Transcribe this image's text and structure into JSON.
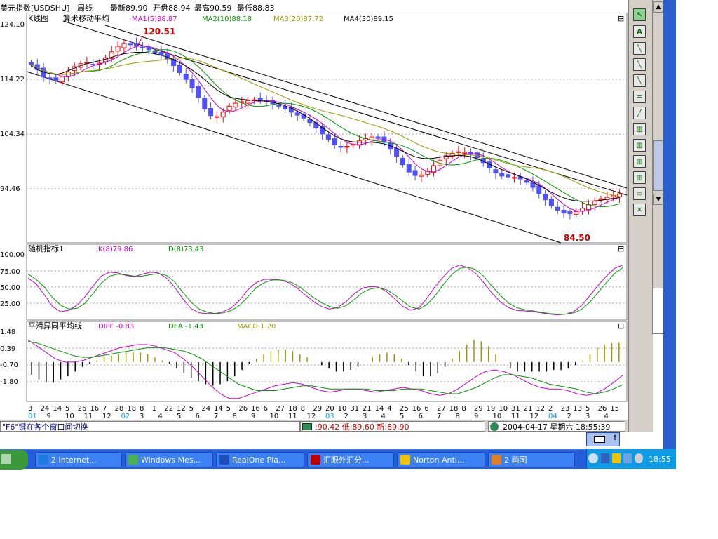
{
  "header": {
    "symbol": "美元指数[USDSHU]",
    "period": "周线",
    "latest": "最新89.90",
    "open": "开盘88.94",
    "high": "最高90.59",
    "low": "最低88.83"
  },
  "panels": {
    "kline": {
      "title": "K线图",
      "indicator": "算术移动平均",
      "ma1": "MA1(5)88.87",
      "ma2": "MA2(10)88.18",
      "ma3": "MA3(20)87.72",
      "ma4": "MA4(30)89.15",
      "high_label": "120.51",
      "low_label": "84.50",
      "yticks": [
        "124.10",
        "114.22",
        "104.34",
        "94.46"
      ]
    },
    "kd": {
      "title": "随机指标1",
      "k": "K(8)79.86",
      "d": "D(8)73.43",
      "yticks": [
        "100.00",
        "75.00",
        "50.00",
        "25.00"
      ]
    },
    "macd": {
      "title": "平滑异同平均线",
      "diff": "DIFF -0.83",
      "dea": "DEA -1.43",
      "macd": "MACD 1.20",
      "yticks": [
        "1.48",
        "0.39",
        "-0.70",
        "-1.80"
      ]
    },
    "panel_toggle": "⊟",
    "add_icon": "⊞"
  },
  "xaxis": {
    "labels": [
      {
        "t": "3",
        "c": "#000000"
      },
      {
        "t": "24",
        "c": "#000000"
      },
      {
        "t": "14",
        "c": "#000000"
      },
      {
        "t": "5",
        "c": "#000000"
      },
      {
        "t": "26",
        "c": "#000000"
      },
      {
        "t": "16",
        "c": "#000000"
      },
      {
        "t": "7",
        "c": "#000000"
      },
      {
        "t": "28",
        "c": "#000000"
      },
      {
        "t": "18",
        "c": "#000000"
      },
      {
        "t": "8",
        "c": "#000000"
      },
      {
        "t": "1",
        "c": "#000000"
      },
      {
        "t": "22",
        "c": "#000000"
      },
      {
        "t": "12",
        "c": "#000000"
      },
      {
        "t": "5",
        "c": "#000000"
      },
      {
        "t": "24",
        "c": "#000000"
      },
      {
        "t": "14",
        "c": "#000000"
      },
      {
        "t": "5",
        "c": "#000000"
      },
      {
        "t": "26",
        "c": "#000000"
      },
      {
        "t": "16",
        "c": "#000000"
      },
      {
        "t": "6",
        "c": "#000000"
      },
      {
        "t": "27",
        "c": "#000000"
      },
      {
        "t": "18",
        "c": "#000000"
      },
      {
        "t": "8",
        "c": "#000000"
      },
      {
        "t": "29",
        "c": "#000000"
      },
      {
        "t": "20",
        "c": "#000000"
      },
      {
        "t": "10",
        "c": "#000000"
      },
      {
        "t": "31",
        "c": "#000000"
      },
      {
        "t": "21",
        "c": "#000000"
      },
      {
        "t": "14",
        "c": "#000000"
      },
      {
        "t": "4",
        "c": "#000000"
      },
      {
        "t": "25",
        "c": "#000000"
      },
      {
        "t": "16",
        "c": "#000000"
      },
      {
        "t": "6",
        "c": "#000000"
      },
      {
        "t": "27",
        "c": "#000000"
      },
      {
        "t": "18",
        "c": "#000000"
      },
      {
        "t": "8",
        "c": "#000000"
      },
      {
        "t": "29",
        "c": "#000000"
      },
      {
        "t": "19",
        "c": "#000000"
      },
      {
        "t": "10",
        "c": "#000000"
      },
      {
        "t": "31",
        "c": "#000000"
      },
      {
        "t": "21",
        "c": "#000000"
      },
      {
        "t": "12",
        "c": "#000000"
      },
      {
        "t": "2",
        "c": "#000000"
      },
      {
        "t": "23",
        "c": "#000000"
      },
      {
        "t": "13",
        "c": "#000000"
      },
      {
        "t": "5",
        "c": "#000000"
      },
      {
        "t": "26",
        "c": "#000000"
      },
      {
        "t": "15",
        "c": "#000000"
      }
    ],
    "sublabels": [
      {
        "t": "01",
        "c": "#00a0ff"
      },
      {
        "t": "9",
        "c": "#000000"
      },
      {
        "t": "10",
        "c": "#000000"
      },
      {
        "t": "11",
        "c": "#000000"
      },
      {
        "t": "12",
        "c": "#000000"
      },
      {
        "t": "02",
        "c": "#00a0ff"
      },
      {
        "t": "3",
        "c": "#000000"
      },
      {
        "t": "4",
        "c": "#000000"
      },
      {
        "t": "5",
        "c": "#000000"
      },
      {
        "t": "6",
        "c": "#000000"
      },
      {
        "t": "7",
        "c": "#000000"
      },
      {
        "t": "8",
        "c": "#000000"
      },
      {
        "t": "9",
        "c": "#000000"
      },
      {
        "t": "10",
        "c": "#000000"
      },
      {
        "t": "11",
        "c": "#000000"
      },
      {
        "t": "12",
        "c": "#000000"
      },
      {
        "t": "03",
        "c": "#00a0ff"
      },
      {
        "t": "2",
        "c": "#000000"
      },
      {
        "t": "3",
        "c": "#000000"
      },
      {
        "t": "4",
        "c": "#000000"
      },
      {
        "t": "5",
        "c": "#000000"
      },
      {
        "t": "6",
        "c": "#000000"
      },
      {
        "t": "7",
        "c": "#000000"
      },
      {
        "t": "8",
        "c": "#000000"
      },
      {
        "t": "9",
        "c": "#000000"
      },
      {
        "t": "10",
        "c": "#000000"
      },
      {
        "t": "11",
        "c": "#000000"
      },
      {
        "t": "12",
        "c": "#000000"
      },
      {
        "t": "04",
        "c": "#00a0ff"
      },
      {
        "t": "2",
        "c": "#000000"
      },
      {
        "t": "3",
        "c": "#000000"
      },
      {
        "t": "4",
        "c": "#000000"
      }
    ]
  },
  "status": {
    "hint": "\"F6\"键在各个窗口间切换",
    "quote": ":90.42 低:89.60 新:89.90",
    "datetime": "2004-04-17 星期六 18:55:39"
  },
  "taskbar": {
    "items": [
      {
        "label": "2 Internet...",
        "icon": "ie-icon",
        "color": "#1f7ae0"
      },
      {
        "label": "Windows Mes...",
        "icon": "messenger-icon",
        "color": "#4caf50"
      },
      {
        "label": "RealOne Pla...",
        "icon": "realone-icon",
        "color": "#1d4fb8"
      },
      {
        "label": "汇眼外汇分...",
        "icon": "forex-icon",
        "color": "#c00000"
      },
      {
        "label": "Norton Anti...",
        "icon": "norton-icon",
        "color": "#f2c200"
      },
      {
        "label": "2 画图",
        "icon": "paint-icon",
        "color": "#e08020"
      }
    ],
    "clock": "18:55"
  },
  "colors": {
    "up": "#ff0000",
    "down": "#5050ff",
    "ma1": "#cc00cc",
    "ma2": "#009900",
    "ma3": "#999900",
    "ma4": "#000000",
    "k": "#cc00cc",
    "d": "#009900",
    "macd_pos": "#999900",
    "macd_neg": "#000000",
    "label_red": "#cc0000"
  },
  "chart_data": [
    {
      "type": "candlestick",
      "title": "K线图",
      "ylim": [
        80,
        124.1
      ],
      "yticks": [
        124.1,
        114.22,
        104.34,
        94.46
      ],
      "high_label": 120.51,
      "low_label": 84.5,
      "close": [
        116.0,
        115.0,
        113.5,
        113.2,
        112.8,
        113.6,
        114.5,
        115.6,
        116.2,
        116.4,
        116.1,
        116.3,
        117.4,
        118.6,
        119.7,
        120.3,
        120.0,
        119.7,
        119.4,
        119.0,
        118.5,
        117.9,
        117.2,
        115.8,
        114.4,
        113.0,
        111.3,
        109.4,
        107.0,
        105.7,
        105.5,
        106.4,
        107.6,
        108.2,
        108.5,
        108.7,
        108.9,
        108.9,
        108.6,
        108.1,
        107.6,
        107.0,
        106.4,
        105.8,
        105.2,
        104.3,
        103.2,
        102.0,
        100.9,
        99.8,
        99.3,
        99.5,
        99.9,
        100.6,
        101.1,
        101.4,
        101.1,
        100.3,
        98.9,
        97.4,
        95.8,
        94.3,
        93.6,
        93.7,
        94.5,
        95.6,
        96.7,
        97.6,
        98.1,
        98.4,
        98.3,
        97.9,
        97.2,
        96.2,
        95.1,
        94.1,
        93.5,
        93.3,
        93.2,
        92.9,
        92.2,
        91.2,
        90.0,
        88.7,
        87.5,
        86.6,
        86.0,
        85.9,
        86.3,
        87.0,
        87.7,
        88.4,
        88.9,
        89.2,
        89.6,
        89.9
      ],
      "ma4_values": [
        115.8,
        115.0,
        114.5,
        114.2,
        114.0,
        114.3,
        114.8,
        115.3,
        115.8,
        116.2,
        116.5,
        116.8,
        117.1,
        117.5,
        117.9,
        118.2,
        118.4,
        118.5,
        118.5,
        118.4,
        118.2,
        117.9,
        117.5,
        117.0,
        116.4,
        115.7,
        114.9,
        114.0,
        113.0,
        111.9,
        110.9,
        110.1,
        109.5,
        109.2,
        109.0,
        108.9,
        108.8,
        108.7,
        108.6,
        108.4,
        108.1,
        107.7,
        107.2,
        106.6,
        105.9,
        105.1,
        104.2,
        103.3,
        102.4,
        101.6,
        101.0,
        100.6,
        100.4,
        100.3,
        100.3,
        100.3,
        100.2,
        100.0,
        99.6,
        99.1,
        98.5,
        97.9,
        97.4,
        97.1,
        97.0,
        97.1,
        97.3,
        97.5,
        97.6,
        97.7,
        97.6,
        97.4,
        97.0,
        96.5,
        95.9,
        95.3,
        94.8,
        94.3,
        93.9,
        93.4,
        92.9,
        92.3,
        91.6,
        90.9,
        90.2,
        89.6,
        89.1,
        88.7,
        88.5,
        88.4,
        88.4,
        88.5,
        88.6,
        88.8,
        89.0,
        89.15
      ]
    },
    {
      "type": "line",
      "title": "随机指标1",
      "ylim": [
        0,
        100
      ],
      "series": [
        {
          "name": "K(8)",
          "values": [
            64,
            55,
            38,
            20,
            12,
            14,
            22,
            35,
            52,
            67,
            73,
            72,
            68,
            66,
            70,
            73,
            72,
            64,
            50,
            32,
            17,
            10,
            9,
            9,
            12,
            18,
            30,
            46,
            57,
            62,
            62,
            61,
            57,
            49,
            38,
            28,
            20,
            16,
            18,
            27,
            39,
            48,
            51,
            50,
            43,
            32,
            20,
            14,
            18,
            33,
            51,
            66,
            79,
            84,
            80,
            71,
            56,
            40,
            27,
            18,
            14,
            13,
            12,
            10,
            8,
            7,
            8,
            12,
            22,
            37,
            53,
            67,
            79,
            84
          ]
        },
        {
          "name": "D(8)",
          "values": [
            70,
            62,
            50,
            34,
            22,
            16,
            17,
            25,
            40,
            56,
            67,
            70,
            69,
            67,
            67,
            69,
            71,
            68,
            58,
            42,
            27,
            16,
            11,
            9,
            10,
            14,
            22,
            35,
            49,
            57,
            61,
            61,
            59,
            53,
            44,
            34,
            26,
            20,
            17,
            21,
            30,
            41,
            47,
            49,
            46,
            38,
            28,
            19,
            16,
            23,
            37,
            54,
            69,
            79,
            81,
            77,
            66,
            51,
            37,
            25,
            18,
            15,
            13,
            11,
            9,
            8,
            8,
            10,
            16,
            27,
            42,
            57,
            71,
            80
          ]
        }
      ]
    },
    {
      "type": "bar+line",
      "title": "平滑异同平均线",
      "ylim": [
        -2.4,
        1.9
      ],
      "series": [
        {
          "name": "MACD",
          "values": [
            -0.8,
            -1.1,
            -1.3,
            -1.3,
            -1.1,
            -0.9,
            -0.6,
            -0.3,
            -0.1,
            0.1,
            0.3,
            0.4,
            0.5,
            0.6,
            0.6,
            0.6,
            0.5,
            0.3,
            0.1,
            -0.1,
            -0.4,
            -0.7,
            -1.0,
            -1.2,
            -1.4,
            -1.5,
            -1.4,
            -1.2,
            -0.9,
            -0.5,
            -0.1,
            0.2,
            0.5,
            0.7,
            0.8,
            0.8,
            0.7,
            0.5,
            0.3,
            0.0,
            -0.2,
            -0.4,
            -0.6,
            -0.6,
            -0.5,
            -0.3,
            0.0,
            0.3,
            0.5,
            0.6,
            0.5,
            0.2,
            -0.2,
            -0.6,
            -0.9,
            -0.9,
            -0.7,
            -0.3,
            0.2,
            0.7,
            1.1,
            1.4,
            1.3,
            1.0,
            0.5,
            0.0,
            -0.4,
            -0.6,
            -0.6,
            -0.6,
            -0.6,
            -0.6,
            -0.5,
            -0.5,
            -0.4,
            -0.2,
            0.1,
            0.5,
            0.9,
            1.1,
            1.2,
            1.2
          ]
        },
        {
          "name": "DIFF",
          "values": [
            1.4,
            1.0,
            0.6,
            0.2,
            0.0,
            0.0,
            0.1,
            0.3,
            0.5,
            0.7,
            0.9,
            1.0,
            1.1,
            1.1,
            1.0,
            0.8,
            0.6,
            0.2,
            -0.3,
            -0.9,
            -1.5,
            -2.0,
            -2.3,
            -2.3,
            -2.1,
            -1.9,
            -1.7,
            -1.5,
            -1.4,
            -1.3,
            -1.4,
            -1.6,
            -1.8,
            -1.9,
            -1.8,
            -1.7,
            -1.7,
            -1.8,
            -1.9,
            -1.8,
            -1.7,
            -1.6,
            -1.7,
            -1.8,
            -2.0,
            -2.1,
            -2.0,
            -1.7,
            -1.3,
            -0.9,
            -0.6,
            -0.5,
            -0.6,
            -0.8,
            -1.1,
            -1.4,
            -1.6,
            -1.7,
            -1.7,
            -1.8,
            -2.0,
            -2.1,
            -2.0,
            -1.7,
            -1.3,
            -0.83
          ]
        },
        {
          "name": "DEA",
          "values": [
            1.3,
            1.2,
            1.0,
            0.8,
            0.6,
            0.4,
            0.3,
            0.3,
            0.4,
            0.5,
            0.6,
            0.7,
            0.8,
            0.9,
            0.9,
            0.9,
            0.8,
            0.7,
            0.5,
            0.2,
            -0.2,
            -0.6,
            -1.0,
            -1.4,
            -1.6,
            -1.8,
            -1.8,
            -1.8,
            -1.7,
            -1.6,
            -1.5,
            -1.5,
            -1.6,
            -1.7,
            -1.7,
            -1.7,
            -1.7,
            -1.7,
            -1.8,
            -1.8,
            -1.8,
            -1.7,
            -1.7,
            -1.7,
            -1.8,
            -1.9,
            -2.0,
            -2.0,
            -1.8,
            -1.6,
            -1.3,
            -1.0,
            -0.8,
            -0.8,
            -0.9,
            -1.0,
            -1.2,
            -1.4,
            -1.5,
            -1.6,
            -1.7,
            -1.9,
            -2.0,
            -1.9,
            -1.7,
            -1.43
          ]
        }
      ]
    }
  ]
}
